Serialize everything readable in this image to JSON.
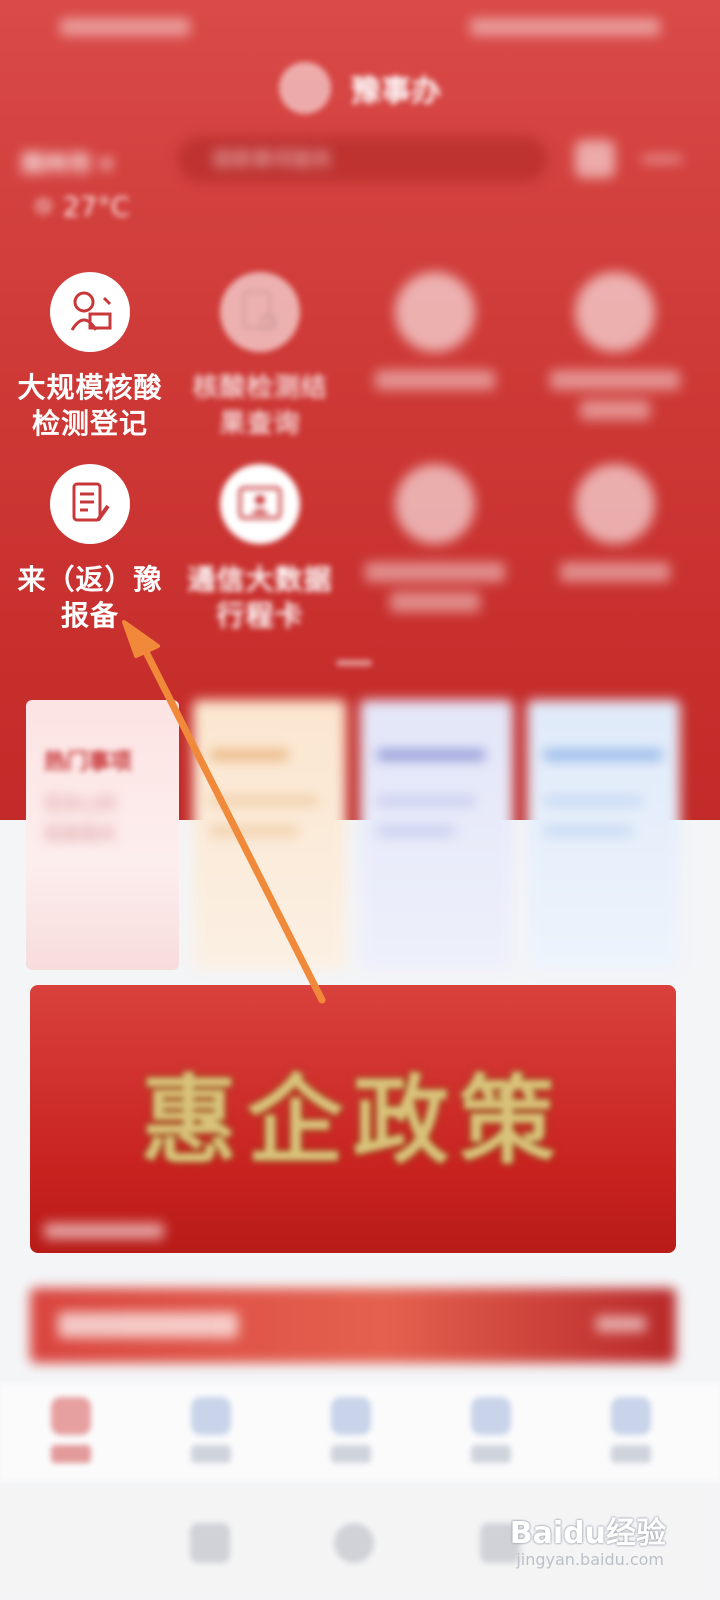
{
  "app": {
    "title": "豫事办"
  },
  "header": {
    "city": "郑州市",
    "search_placeholder": "搜索事项服务",
    "weather": {
      "temp": "27°C"
    }
  },
  "grid": {
    "items": [
      {
        "label": "大规模核酸检测登记",
        "line1": "大规模核酸",
        "line2": "检测登记",
        "icon": "person-signature-icon"
      },
      {
        "label": "核酸检测结果查询",
        "line1": "核酸检测结",
        "line2": "果查询",
        "icon": "document-search-icon"
      },
      {
        "label": "",
        "icon": "service-icon"
      },
      {
        "label": "",
        "icon": "service-icon"
      },
      {
        "label": "来（返）豫报备",
        "line1": "来（返）豫",
        "line2": "报备",
        "icon": "document-edit-icon"
      },
      {
        "label": "通信大数据行程卡",
        "line1": "通信大数据",
        "line2": "行程卡",
        "icon": "id-card-icon"
      },
      {
        "label": "",
        "icon": "shield-icon"
      },
      {
        "label": "",
        "icon": "service-icon"
      }
    ]
  },
  "cards": [
    {
      "title": "热门事项",
      "sub1": "您关心的",
      "sub2": "就是我关"
    },
    {
      "title": ""
    },
    {
      "title": ""
    },
    {
      "title": ""
    }
  ],
  "banner": {
    "title": "惠企政策"
  },
  "strip": {
    "title": "",
    "more": ""
  },
  "nav": {
    "items": [
      {
        "label": ""
      },
      {
        "label": ""
      },
      {
        "label": ""
      },
      {
        "label": ""
      },
      {
        "label": ""
      }
    ]
  },
  "watermark": {
    "brand": "Baidu经验",
    "url": "jingyan.baidu.com"
  },
  "colors": {
    "brand": "#cf3b38",
    "arrow": "#f08a3a"
  }
}
